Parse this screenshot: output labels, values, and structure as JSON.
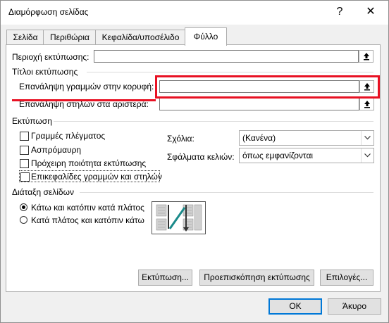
{
  "window": {
    "title": "Διαμόρφωση σελίδας",
    "help_glyph": "?",
    "close_glyph": "✕"
  },
  "tabs": [
    {
      "label": "Σελίδα"
    },
    {
      "label": "Περιθώρια"
    },
    {
      "label": "Κεφαλίδα/υποσέλιδο"
    },
    {
      "label": "Φύλλο"
    }
  ],
  "print_area": {
    "label": "Περιοχή εκτύπωσης:",
    "value": ""
  },
  "print_titles": {
    "group_label": "Τίτλοι εκτύπωσης",
    "rows_label": "Επανάληψη γραμμών στην κορυφή:",
    "rows_value": "",
    "cols_label": "Επανάληψη στηλών στα αριστερά:",
    "cols_value": ""
  },
  "print": {
    "group_label": "Εκτύπωση",
    "gridlines": {
      "label": "Γραμμές πλέγματος",
      "checked": false
    },
    "black_white": {
      "label": "Ασπρόμαυρη",
      "checked": false
    },
    "draft": {
      "label": "Πρόχειρη ποιότητα εκτύπωσης",
      "checked": false
    },
    "headings": {
      "label": "Επικεφαλίδες γραμμών και στηλών",
      "checked": false
    },
    "comments_label": "Σχόλια:",
    "comments_value": "(Κανένα)",
    "errors_label": "Σφάλματα κελιών:",
    "errors_value": "όπως εμφανίζονται"
  },
  "page_order": {
    "group_label": "Διάταξη σελίδων",
    "down_then_over": "Κάτω και κατόπιν κατά πλάτος",
    "over_then_down": "Κατά πλάτος και κατόπιν κάτω",
    "selected": "down_then_over"
  },
  "buttons": {
    "print": "Εκτύπωση...",
    "preview": "Προεπισκόπηση εκτύπωσης",
    "options": "Επιλογές...",
    "ok": "OK",
    "cancel": "Άκυρο"
  },
  "colors": {
    "highlight": "#e81123",
    "accent": "#0078d7"
  }
}
